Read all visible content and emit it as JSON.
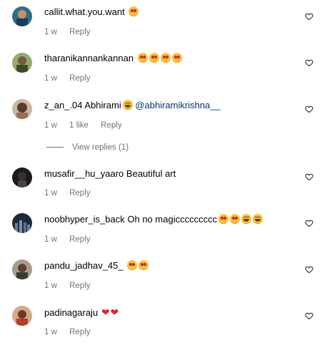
{
  "comments": [
    {
      "username": "callit.what.you.want",
      "text": "",
      "emojis": [
        "heart-eyes"
      ],
      "time": "1 w",
      "likes": "",
      "reply": "Reply"
    },
    {
      "username": "tharanikannankannan",
      "text": "",
      "emojis": [
        "heart-eyes",
        "heart-eyes",
        "heart-eyes",
        "heart-eyes"
      ],
      "time": "1 w",
      "likes": "",
      "reply": "Reply"
    },
    {
      "username": "z_an_.04",
      "text": "Abhirami",
      "emojis": [
        "grin"
      ],
      "mention": "@abhiramikrishna__",
      "time": "1 w",
      "likes": "1 like",
      "reply": "Reply"
    },
    {
      "username": "musafir__hu_yaaro",
      "text": "Beautiful art",
      "emojis": [],
      "time": "1 w",
      "likes": "",
      "reply": "Reply"
    },
    {
      "username": "noobhyper_is_back",
      "text": "Oh no magiccccccccc",
      "emojis": [
        "heart-eyes",
        "heart-eyes",
        "grin",
        "grin"
      ],
      "time": "1 w",
      "likes": "",
      "reply": "Reply"
    },
    {
      "username": "pandu_jadhav_45_",
      "text": "",
      "emojis": [
        "heart-eyes",
        "heart-eyes"
      ],
      "time": "1 w",
      "likes": "",
      "reply": "Reply"
    },
    {
      "username": "padinagaraju",
      "text": "",
      "emojis": [
        "heart",
        "heart"
      ],
      "time": "1 w",
      "likes": "",
      "reply": "Reply"
    }
  ],
  "view_replies": "View replies (1)"
}
